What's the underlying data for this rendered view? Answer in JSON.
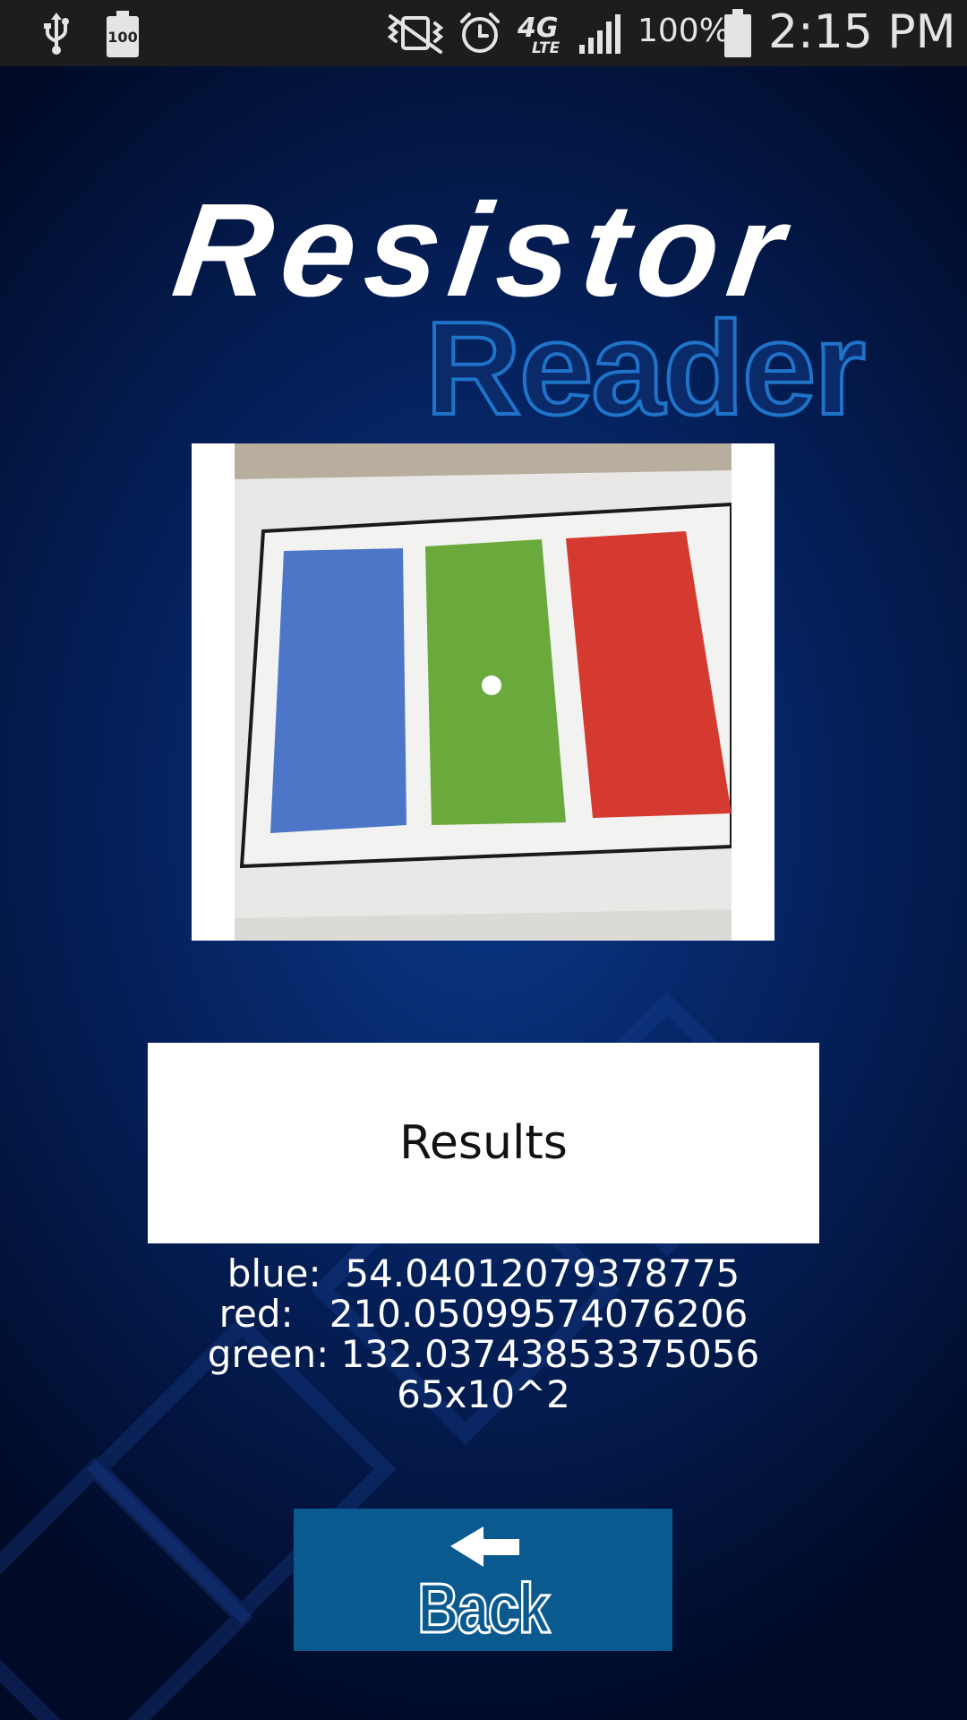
{
  "status_bar": {
    "battery_small_label": "100",
    "network_label": "4G",
    "network_sub_label": "LTE",
    "battery_percent": "100%",
    "time": "2:15 PM",
    "icons": [
      "usb-icon",
      "battery-saver-icon",
      "vibrate-mute-icon",
      "alarm-icon",
      "lte-icon",
      "signal-icon",
      "battery-icon"
    ]
  },
  "app": {
    "logo_line1": "Resistor",
    "logo_line2": "Reader",
    "colors": {
      "background": "#062769",
      "logo_primary": "#ffffff",
      "logo_secondary": "#1f73c9",
      "button_bg": "#0b5a8f"
    }
  },
  "photo": {
    "swatches": [
      "blue",
      "green",
      "red"
    ],
    "colors": {
      "blue": "#4d76c8",
      "green": "#6aaa3c",
      "red": "#d43a30"
    }
  },
  "results": {
    "button_label": "Results",
    "lines": [
      "blue:  54.04012079378775",
      "red:   210.05099574076206",
      "green: 132.03743853375056",
      "65x10^2"
    ]
  },
  "back": {
    "label": "Back"
  }
}
